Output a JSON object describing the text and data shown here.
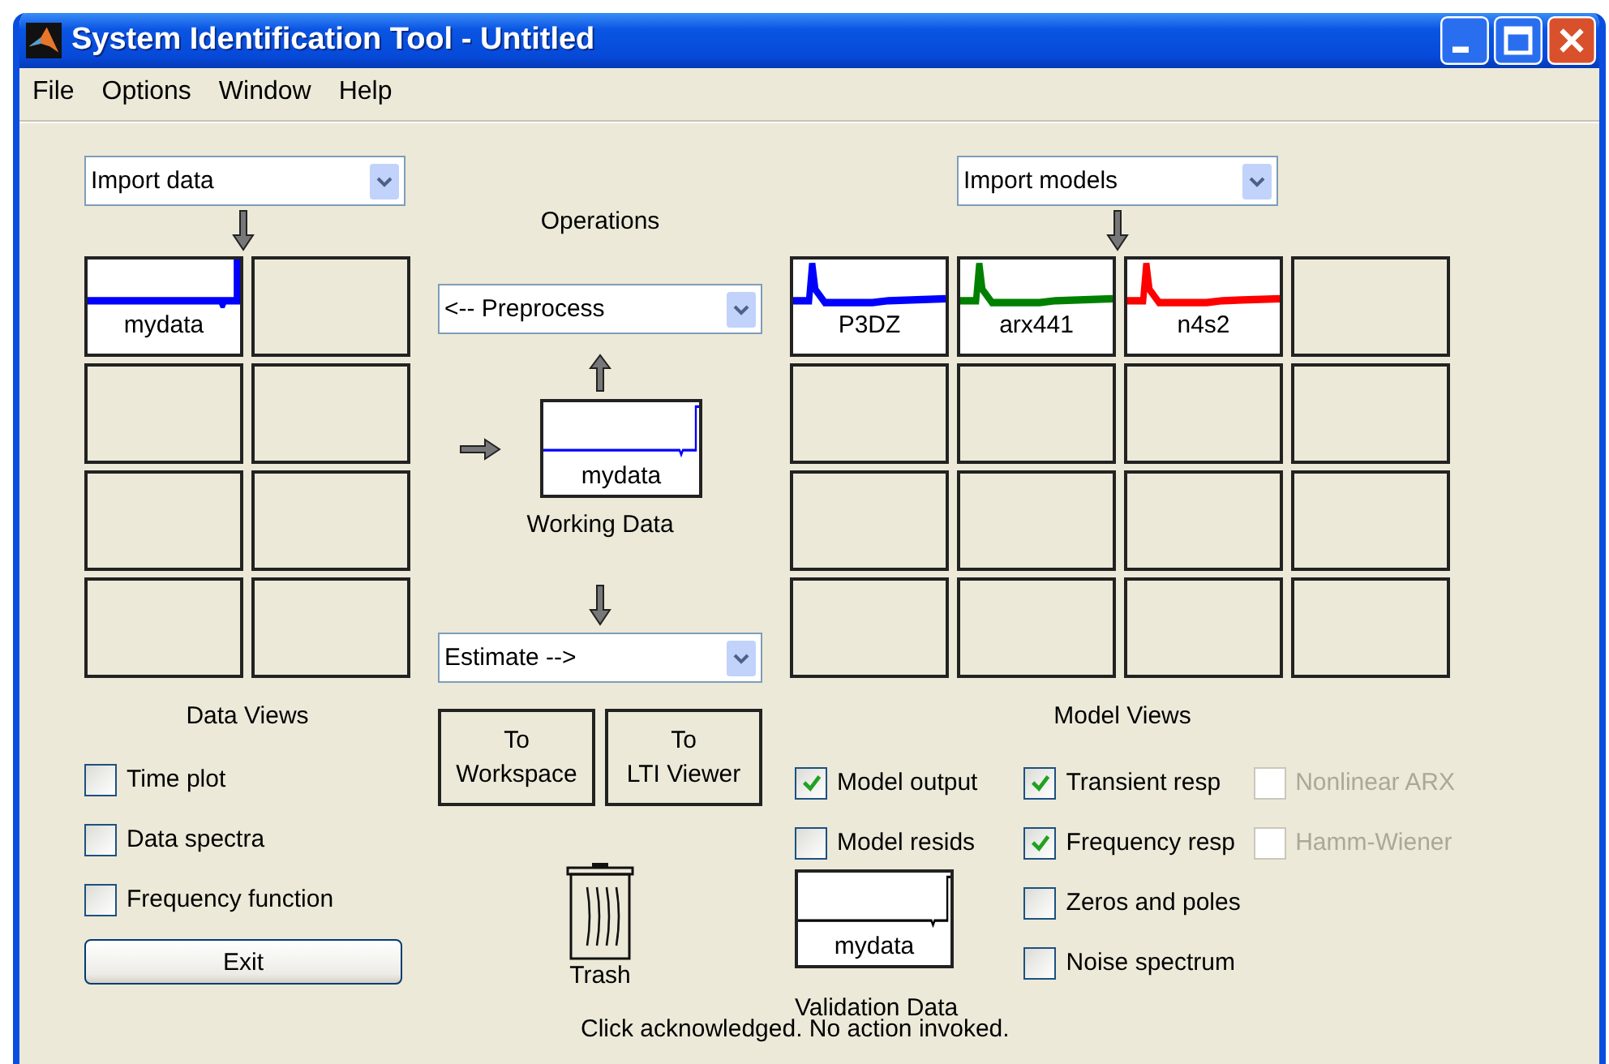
{
  "window": {
    "title": "System Identification Tool - Untitled"
  },
  "menu": [
    "File",
    "Options",
    "Window",
    "Help"
  ],
  "data_import": {
    "value": "Import data"
  },
  "data_boards": [
    {
      "kind": "signal",
      "label": "mydata",
      "color": "#0000ff"
    },
    {
      "kind": "empty"
    },
    {
      "kind": "empty"
    },
    {
      "kind": "empty"
    },
    {
      "kind": "empty"
    },
    {
      "kind": "empty"
    },
    {
      "kind": "empty"
    },
    {
      "kind": "empty"
    }
  ],
  "data_views": {
    "title": "Data Views",
    "checkboxes": [
      {
        "label": "Time plot",
        "checked": false,
        "disabled": false
      },
      {
        "label": "Data spectra",
        "checked": false,
        "disabled": false
      },
      {
        "label": "Frequency function",
        "checked": false,
        "disabled": false
      }
    ]
  },
  "exit_button": "Exit",
  "operations": {
    "title": "Operations",
    "preprocess": "<-- Preprocess",
    "working_data": {
      "label": "mydata",
      "caption": "Working Data"
    },
    "estimate": "Estimate -->",
    "buttons": [
      {
        "lines": [
          "To",
          "Workspace"
        ]
      },
      {
        "lines": [
          "To",
          "LTI Viewer"
        ]
      }
    ],
    "trash": "Trash"
  },
  "model_import": {
    "value": "Import models"
  },
  "model_boards": [
    {
      "kind": "response",
      "label": "P3DZ",
      "color": "#0000ff"
    },
    {
      "kind": "response",
      "label": "arx441",
      "color": "#008000"
    },
    {
      "kind": "response",
      "label": "n4s2",
      "color": "#ff0000"
    },
    {
      "kind": "empty"
    },
    {
      "kind": "empty"
    },
    {
      "kind": "empty"
    },
    {
      "kind": "empty"
    },
    {
      "kind": "empty"
    },
    {
      "kind": "empty"
    },
    {
      "kind": "empty"
    },
    {
      "kind": "empty"
    },
    {
      "kind": "empty"
    },
    {
      "kind": "empty"
    },
    {
      "kind": "empty"
    },
    {
      "kind": "empty"
    },
    {
      "kind": "empty"
    }
  ],
  "model_views": {
    "title": "Model Views",
    "columns": [
      [
        {
          "label": "Model output",
          "checked": true,
          "disabled": false
        },
        {
          "label": "Model resids",
          "checked": false,
          "disabled": false
        }
      ],
      [
        {
          "label": "Transient resp",
          "checked": true,
          "disabled": false
        },
        {
          "label": "Frequency resp",
          "checked": true,
          "disabled": false
        },
        {
          "label": "Zeros and poles",
          "checked": false,
          "disabled": false
        },
        {
          "label": "Noise spectrum",
          "checked": false,
          "disabled": false
        }
      ],
      [
        {
          "label": "Nonlinear ARX",
          "checked": false,
          "disabled": true
        },
        {
          "label": "Hamm-Wiener",
          "checked": false,
          "disabled": true
        }
      ]
    ]
  },
  "validation_data": {
    "label": "mydata",
    "caption": "Validation Data"
  },
  "status": "Click acknowledged. No action invoked."
}
